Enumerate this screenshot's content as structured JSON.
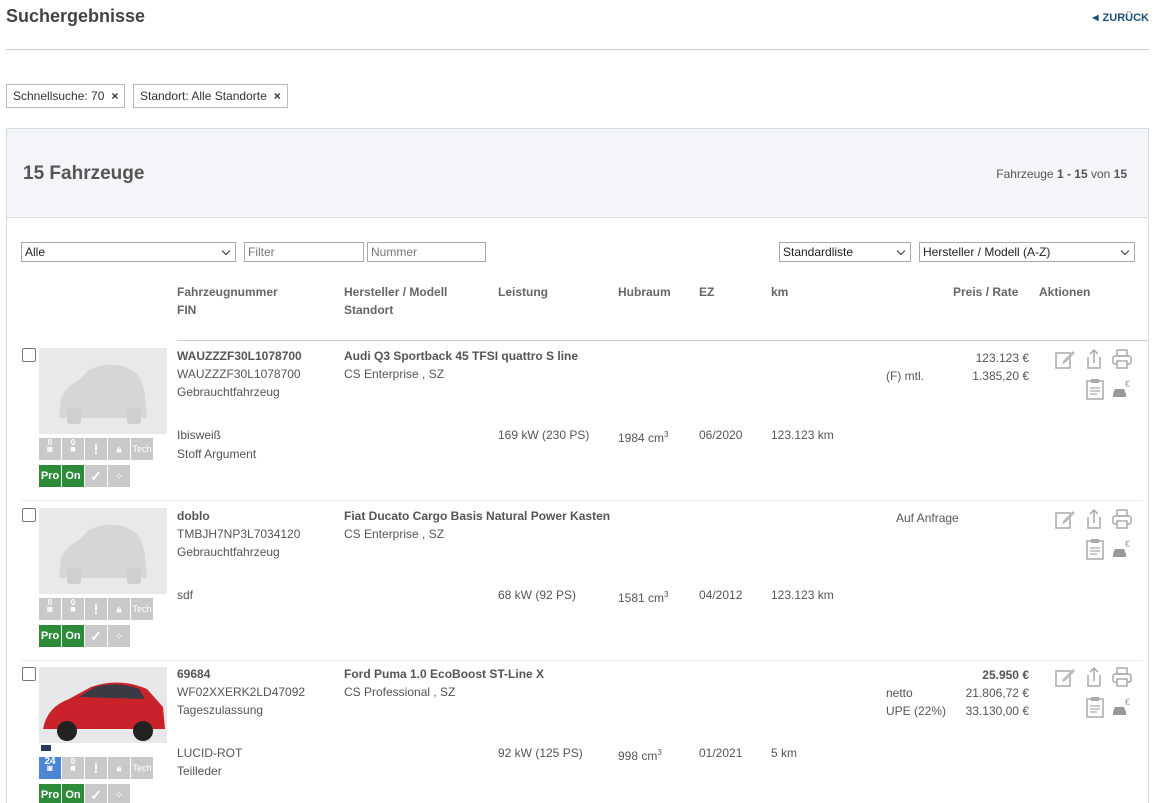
{
  "header": {
    "title": "Suchergebnisse",
    "back": "ZURÜCK"
  },
  "chips": [
    {
      "label": "Schnellsuche: 70",
      "remove": "×"
    },
    {
      "label": "Standort: Alle Standorte",
      "remove": "×"
    }
  ],
  "summary": {
    "count_title": "15 Fahrzeuge",
    "pager_prefix": "Fahrzeuge ",
    "pager_range": "1 - 15",
    "pager_mid": " von ",
    "pager_total": "15"
  },
  "controls": {
    "filter_select": "Alle",
    "filter_placeholder": "Filter",
    "nummer_placeholder": "Nummer",
    "list_select": "Standardliste",
    "sort_select": "Hersteller / Modell (A-Z)"
  },
  "columns": {
    "fzg_nr": "Fahrzeugnummer",
    "fin": "FIN",
    "hersteller": "Hersteller / Modell",
    "standort": "Standort",
    "leistung": "Leistung",
    "hubraum": "Hubraum",
    "ez": "EZ",
    "km": "km",
    "preis": "Preis / Rate",
    "aktionen": "Aktionen"
  },
  "vehicles": [
    {
      "nummer": "WAUZZZF30L1078700",
      "fin": "WAUZZZF30L1078700",
      "status": "Gebrauchtfahrzeug",
      "modell": "Audi Q3 Sportback 45 TFSI quattro S line",
      "standort": "CS Enterprise , SZ",
      "farbe": "Ibisweiß",
      "polster": "Stoff Argument",
      "leistung": "169 kW (230 PS)",
      "hubraum": "1984 cm",
      "ez": "06/2020",
      "km": "123.123 km",
      "preis_zeilen": [
        {
          "label": "",
          "wert": "123.123 €"
        },
        {
          "label": "(F) mtl.",
          "wert": "1.385,20 €"
        }
      ],
      "icon_counts": {
        "foto": "0",
        "video": "0"
      },
      "badges": {
        "pro": "Pro",
        "on": "On",
        "tech": "Tech"
      }
    },
    {
      "nummer": "doblo",
      "fin": "TMBJH7NP3L7034120",
      "status": "Gebrauchtfahrzeug",
      "modell": "Fiat Ducato Cargo Basis Natural Power Kasten",
      "standort": "CS Enterprise , SZ",
      "farbe": "sdf",
      "polster": "",
      "leistung": "68 kW (92 PS)",
      "hubraum": "1581 cm",
      "ez": "04/2012",
      "km": "123.123 km",
      "preis_anfrage": "Auf Anfrage",
      "icon_counts": {
        "foto": "0",
        "video": "0"
      },
      "badges": {
        "pro": "Pro",
        "on": "On",
        "tech": "Tech"
      }
    },
    {
      "nummer": "69684",
      "fin": "WF02XXERK2LD47092",
      "status": "Tageszulassung",
      "modell": "Ford Puma 1.0 EcoBoost ST-Line X",
      "standort": "CS Professional , SZ",
      "farbe": "LUCID-ROT",
      "polster": "Teilleder",
      "leistung": "92 kW (125 PS)",
      "hubraum": "998 cm",
      "ez": "01/2021",
      "km": "5 km",
      "preis_zeilen": [
        {
          "label": "",
          "wert": "25.950 €"
        },
        {
          "label": "netto",
          "wert": "21.806,72 €"
        },
        {
          "label": "UPE (22%)",
          "wert": "33.130,00 €"
        }
      ],
      "icon_counts": {
        "foto": "24",
        "video": "0"
      },
      "badges": {
        "pro": "Pro",
        "on": "On",
        "tech": "Tech"
      }
    }
  ],
  "hubraum_exp": "3",
  "colors": {
    "green_badge": "#2e8b3a",
    "blue_badge": "#4a86d4",
    "link": "#1a4f7a"
  }
}
